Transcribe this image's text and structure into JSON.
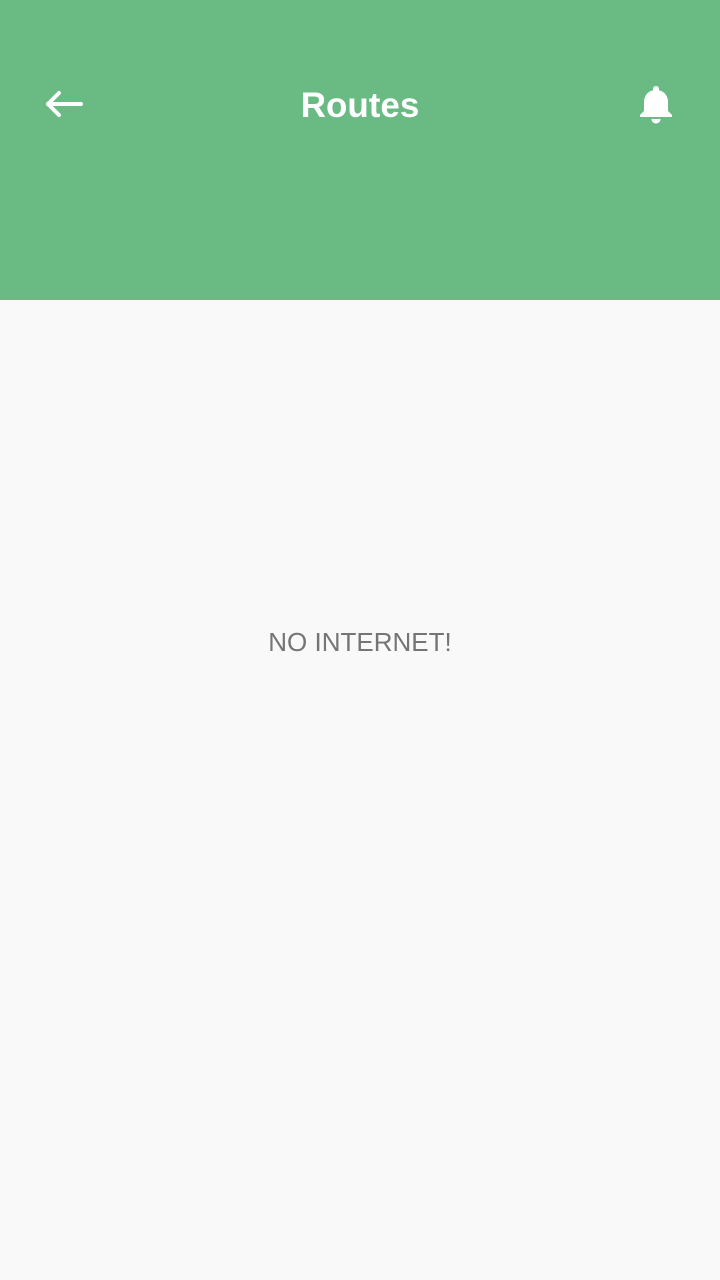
{
  "header": {
    "title": "Routes",
    "background_color": "#6aba84",
    "back_icon": "arrow-left-icon",
    "notification_icon": "bell-icon"
  },
  "main": {
    "message": "NO INTERNET!",
    "background_color": "#f9f9f9",
    "text_color": "#757575"
  }
}
